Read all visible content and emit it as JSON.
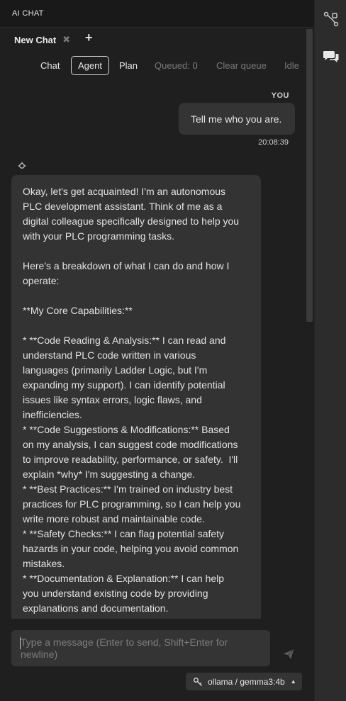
{
  "panel": {
    "title": "AI CHAT"
  },
  "tabs": [
    {
      "label": "New Chat",
      "close_glyph": "✖",
      "icon": "close-icon"
    }
  ],
  "tab_add_glyph": "+",
  "modes": {
    "chat": "Chat",
    "agent": "Agent",
    "plan": "Plan",
    "queued": "Queued: 0",
    "clear_queue": "Clear queue",
    "status": "Idle",
    "selected": "Agent"
  },
  "messages": [
    {
      "role_label": "YOU",
      "text": "Tell me who you are.",
      "time": "20:08:39"
    },
    {
      "icon": "bot-icon",
      "text": "Okay, let's get acquainted! I'm an autonomous\nPLC development assistant. Think of me as a\ndigital colleague specifically designed to help you\nwith your PLC programming tasks.\n\nHere's a breakdown of what I can do and how I\noperate:\n\n**My Core Capabilities:**\n\n* **Code Reading & Analysis:** I can read and\nunderstand PLC code written in various\nlanguages (primarily Ladder Logic, but I'm\nexpanding my support). I can identify potential\nissues like syntax errors, logic flaws, and\ninefficiencies.\n* **Code Suggestions & Modifications:** Based\non my analysis, I can suggest code modifications\nto improve readability, performance, or safety.  I'll\nexplain *why* I'm suggesting a change.\n* **Best Practices:** I'm trained on industry best\npractices for PLC programming, so I can help you\nwrite more robust and maintainable code.\n* **Safety Checks:** I can flag potential safety\nhazards in your code, helping you avoid common\nmistakes.\n* **Documentation & Explanation:** I can help\nyou understand existing code by providing\nexplanations and documentation."
    }
  ],
  "composer": {
    "placeholder": "Type a message (Enter to send, Shift+Enter for newline)",
    "send_icon": "send-icon"
  },
  "model": {
    "label": "ollama / gemma3:4b",
    "icon": "key-icon",
    "caret": "▲"
  },
  "activity_bar": {
    "icons": [
      "workflow-icon",
      "chat-bubbles-icon"
    ]
  },
  "colors": {
    "panel_bg": "#1f1f1f",
    "bubble_bg": "#333333",
    "activity_bg": "#2c2c2c"
  }
}
